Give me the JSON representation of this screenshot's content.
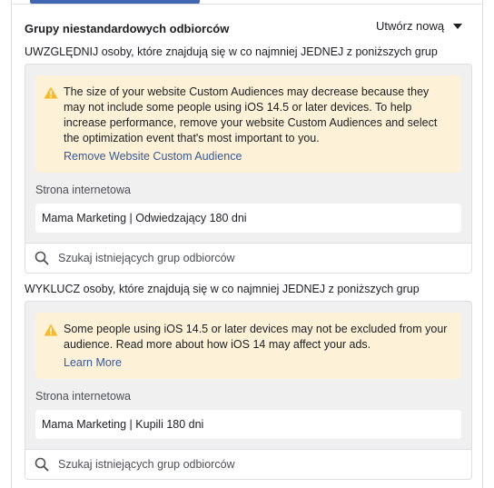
{
  "header": {
    "title": "Grupy niestandardowych odbiorców",
    "create_new_label": "Utwórz nową"
  },
  "include": {
    "heading": "UWZGLĘDNIJ osoby, które znajdują się w co najmniej JEDNEJ z poniższych grup",
    "warning": {
      "text": "The size of your website Custom Audiences may decrease because they may not include some people using iOS 14.5 or later devices. To help increase performance, remove your website Custom Audiences and select the optimization event that's most important to you.",
      "link": "Remove Website Custom Audience"
    },
    "source_label": "Strona internetowa",
    "audience": "Mama Marketing | Odwiedzający 180 dni",
    "search_placeholder": "Szukaj istniejących grup odbiorców"
  },
  "exclude": {
    "heading": "WYKLUCZ osoby, które znajdują się w co najmniej JEDNEJ z poniższych grup",
    "warning": {
      "text": "Some people using iOS 14.5 or later devices may not be excluded from your audience. Read more about how iOS 14 may affect your ads.",
      "link": "Learn More"
    },
    "source_label": "Strona internetowa",
    "audience": "Mama Marketing | Kupili 180 dni",
    "search_placeholder": "Szukaj istniejących grup odbiorców"
  },
  "colors": {
    "accent": "#4267b2",
    "link": "#385898",
    "warning_bg": "#fdf2d8",
    "warning_icon": "#f7b928"
  }
}
